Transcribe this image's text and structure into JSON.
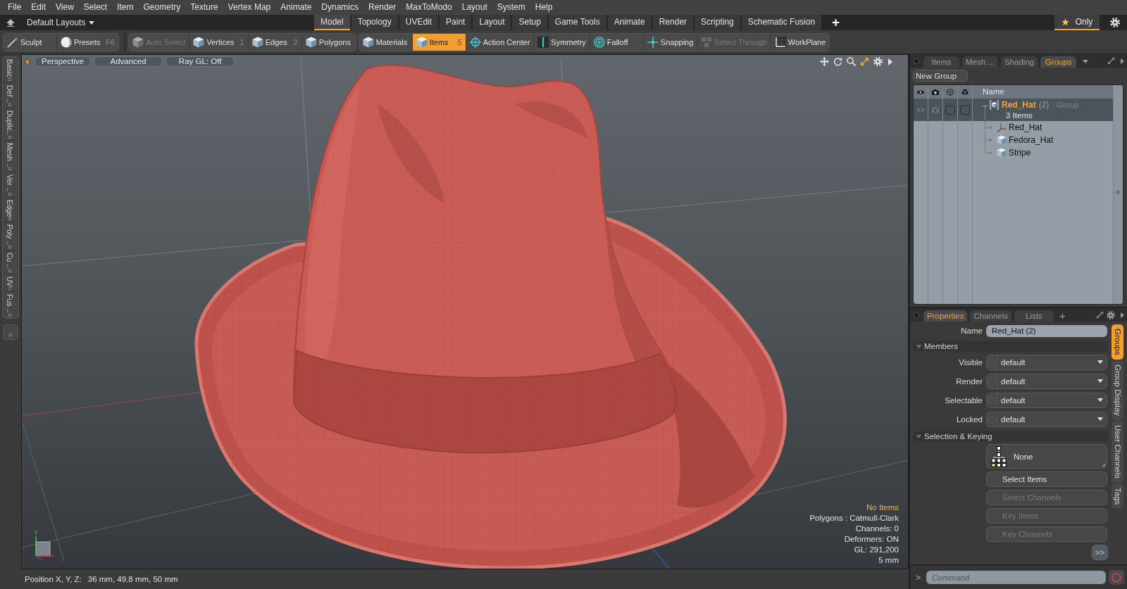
{
  "menu_bar": [
    "File",
    "Edit",
    "View",
    "Select",
    "Item",
    "Geometry",
    "Texture",
    "Vertex Map",
    "Animate",
    "Dynamics",
    "Render",
    "MaxToModo",
    "Layout",
    "System",
    "Help"
  ],
  "layout_bar": {
    "layout_menu": "Default Layouts",
    "tabs": [
      {
        "label": "Model",
        "selected": true
      },
      {
        "label": "Topology",
        "selected": false
      },
      {
        "label": "UVEdit",
        "selected": false
      },
      {
        "label": "Paint",
        "selected": false
      },
      {
        "label": "Layout",
        "selected": false
      },
      {
        "label": "Setup",
        "selected": false
      },
      {
        "label": "Game Tools",
        "selected": false
      },
      {
        "label": "Animate",
        "selected": false
      },
      {
        "label": "Render",
        "selected": false
      },
      {
        "label": "Scripting",
        "selected": false
      },
      {
        "label": "Schematic Fusion",
        "selected": false
      }
    ],
    "add_tab": "+",
    "only_filter": {
      "label": "Only",
      "on": true
    }
  },
  "toolbar": {
    "groups": [
      {
        "items": [
          {
            "label": "Sculpt",
            "kind": "brush",
            "disabled": false,
            "selected": false
          },
          {
            "label": "Presets",
            "shortcut": "F6",
            "kind": "sphere",
            "disabled": false,
            "selected": false
          }
        ]
      },
      {
        "items": [
          {
            "label": "Auto Select",
            "kind": "cube",
            "disabled": true,
            "selected": false
          },
          {
            "label": "Vertices",
            "shortcut": "1",
            "kind": "cube",
            "disabled": false,
            "selected": false
          },
          {
            "label": "Edges",
            "shortcut": "2",
            "kind": "cube",
            "disabled": false,
            "selected": false
          },
          {
            "label": "Polygons",
            "kind": "cube",
            "disabled": false,
            "selected": false
          }
        ]
      },
      {
        "items": [
          {
            "label": "Materials",
            "kind": "cube",
            "disabled": false,
            "selected": false
          },
          {
            "label": "Items",
            "shortcut": "5",
            "kind": "cube",
            "disabled": false,
            "selected": true
          },
          {
            "label": "Action Center",
            "kind": "crosshair",
            "disabled": false,
            "selected": false
          },
          {
            "label": "Symmetry",
            "kind": "bar",
            "disabled": false,
            "selected": false
          },
          {
            "label": "Falloff",
            "kind": "rings",
            "disabled": false,
            "selected": false
          },
          {
            "label": "Snapping",
            "kind": "cross",
            "disabled": false,
            "selected": false
          },
          {
            "label": "Select Through",
            "kind": "cubes",
            "disabled": true,
            "selected": false
          },
          {
            "label": "WorkPlane",
            "kind": "grid",
            "disabled": false,
            "selected": false
          }
        ]
      }
    ]
  },
  "left_tabs": [
    "Basic",
    "Def ..",
    "Duplic..",
    "Mesh ..",
    "Ver ..",
    "Edge",
    "Poly ..",
    "Cu ..",
    "UV",
    "Fus .."
  ],
  "viewport": {
    "view_buttons": [
      "Perspective",
      "Advanced",
      "Ray GL: Off"
    ],
    "axis_label": "Y",
    "info": [
      {
        "text": "No Items",
        "kind": "warning"
      },
      {
        "text": "Polygons : Catmull-Clark",
        "kind": "plain"
      },
      {
        "text": "Channels: 0",
        "kind": "plain"
      },
      {
        "text": "Deformers: ON",
        "kind": "plain"
      },
      {
        "text": "GL: 291,200",
        "kind": "plain"
      },
      {
        "text": "5 mm",
        "kind": "plain"
      }
    ]
  },
  "status_bar": {
    "label": "Position X, Y, Z:",
    "value": "36 mm, 49.8 mm, 50 mm"
  },
  "item_panel": {
    "tabs": [
      {
        "label": "Items",
        "selected": false
      },
      {
        "label": "Mesh ...",
        "selected": false
      },
      {
        "label": "Shading",
        "selected": false
      },
      {
        "label": "Groups",
        "selected": true
      }
    ],
    "new_group": "New Group",
    "tree": {
      "name_header": "Name",
      "groups": [
        {
          "name": "Red_Hat",
          "count": "(2)",
          "type": ": Group",
          "summary": "3 Items",
          "expanded": true,
          "toggles": [
            {
              "checked": false
            },
            {
              "checked": false
            }
          ],
          "children": [
            {
              "name": "Red_Hat",
              "kind": "locator"
            },
            {
              "name": "Fedora_Hat",
              "kind": "mesh"
            },
            {
              "name": "Stripe",
              "kind": "mesh"
            }
          ]
        }
      ]
    }
  },
  "properties_panel": {
    "tabs": [
      {
        "label": "Properties",
        "selected": true
      },
      {
        "label": "Channels",
        "selected": false
      },
      {
        "label": "Lists",
        "selected": false
      }
    ],
    "add_tab": "+",
    "name_label": "Name",
    "name_value": "Red_Hat (2)",
    "sections": [
      {
        "title": "Members",
        "expanded": true,
        "kind": "dropdowns",
        "rows": [
          {
            "label": "Visible",
            "value": "default"
          },
          {
            "label": "Render",
            "value": "default"
          },
          {
            "label": "Selectable",
            "value": "default"
          },
          {
            "label": "Locked",
            "value": "default"
          }
        ]
      },
      {
        "title": "Selection & Keying",
        "expanded": true,
        "kind": "buttons",
        "buttons": [
          {
            "label": "None",
            "kind": "hierarchy",
            "disabled": false
          },
          {
            "label": "Select Items",
            "kind": "plain",
            "disabled": false
          },
          {
            "label": "Select Channels",
            "kind": "plain",
            "disabled": true
          },
          {
            "label": "Key Items",
            "kind": "plain",
            "disabled": true
          },
          {
            "label": "Key Channels",
            "kind": "plain",
            "disabled": true
          }
        ]
      }
    ],
    "more_button": ">>",
    "side_tabs": [
      {
        "label": "Groups",
        "selected": true
      },
      {
        "label": "Group Display",
        "selected": false
      },
      {
        "label": "User Channels",
        "selected": false
      },
      {
        "label": "Tags",
        "selected": false
      }
    ]
  },
  "command_bar": {
    "prompt": ">",
    "placeholder": "Command"
  }
}
